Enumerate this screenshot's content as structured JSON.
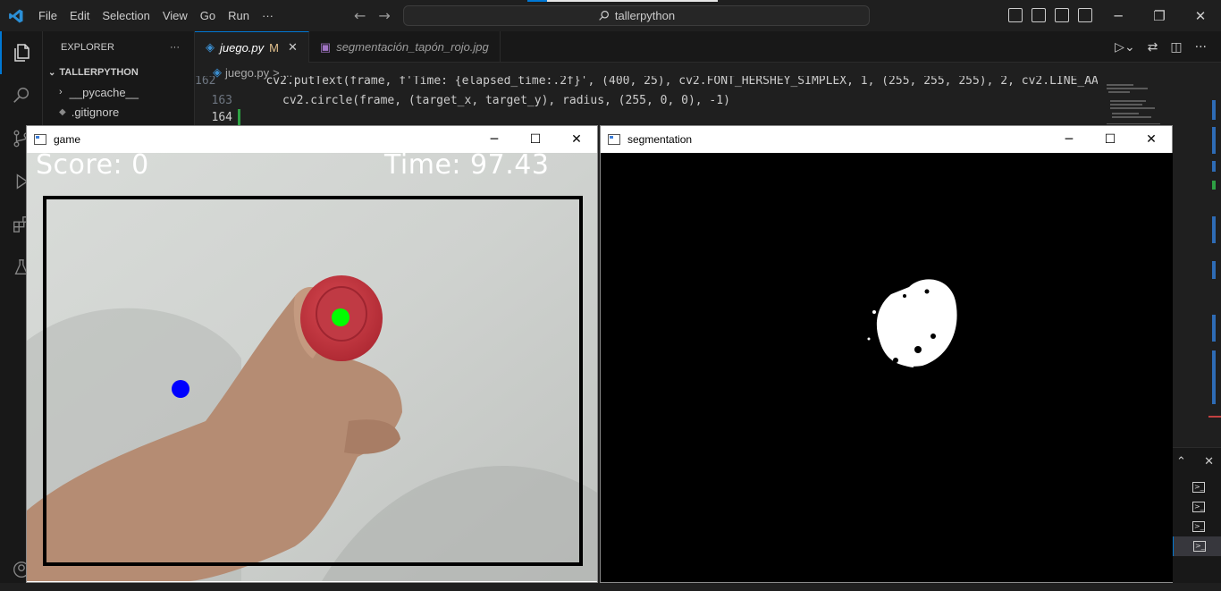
{
  "titlebar": {
    "menu": [
      "File",
      "Edit",
      "Selection",
      "View",
      "Go",
      "Run",
      "···"
    ],
    "search_text": "tallerpython"
  },
  "sidebar": {
    "header": "EXPLORER",
    "more": "···",
    "root": "TALLERPYTHON",
    "items": [
      {
        "label": "__pycache__",
        "type": "folder"
      },
      {
        "label": ".gitignore",
        "type": "file"
      }
    ]
  },
  "tabs": [
    {
      "label": "juego.py",
      "modified": "M",
      "active": true
    },
    {
      "label": "segmentación_tapón_rojo.jpg",
      "active": false
    }
  ],
  "breadcrumb": {
    "file": "juego.py",
    "rest": "> ..."
  },
  "code": {
    "lines": [
      {
        "number": "162",
        "text": "cv2.putText(frame, f'Time: {elapsed_time:.2f}', (400, 25), cv2.FONT_HERSHEY_SIMPLEX, 1, (255, 255, 255), 2, cv2.LINE_AA)"
      },
      {
        "number": "163",
        "text": "cv2.circle(frame, (target_x, target_y), radius, (255, 0, 0), -1)"
      },
      {
        "number": "164",
        "text": ""
      }
    ]
  },
  "game_window": {
    "title": "game",
    "score_text": "Score: 0",
    "time_text": "Time: 97.43"
  },
  "segmentation_window": {
    "title": "segmentation"
  },
  "colors": {
    "accent": "#0078d4",
    "target_dot": "#0000ff",
    "tracker_dot": "#00ff00",
    "cap": "#c8323c"
  }
}
